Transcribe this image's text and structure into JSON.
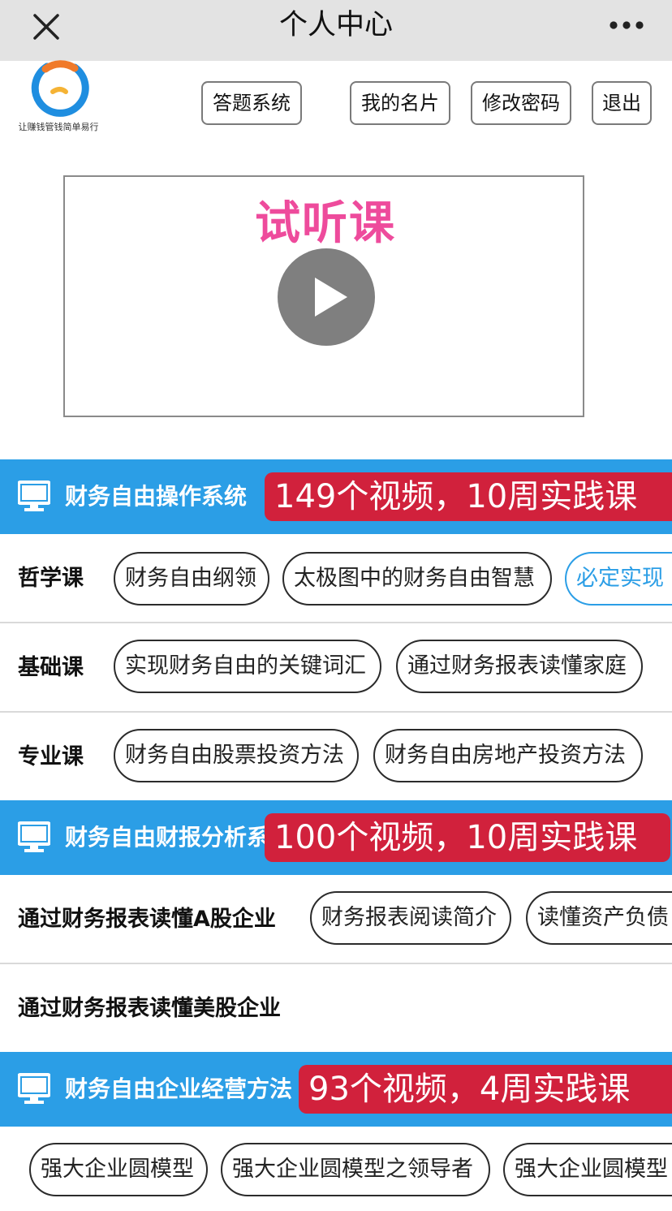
{
  "nav": {
    "title": "个人中心",
    "close_icon": "close-icon",
    "more_icon": "more-icon"
  },
  "header": {
    "logo_icon": "logo-icon",
    "logo_text": "让赚钱管钱简单易行",
    "buttons": [
      "答题系统",
      "我的名片",
      "修改密码",
      "退出"
    ]
  },
  "video": {
    "title": "试听课",
    "play_icon": "play-icon"
  },
  "sections": [
    {
      "title": "财务自由操作系统",
      "badge": "149个视频，10周实践课",
      "icon": "monitor-icon",
      "rows": [
        {
          "label": "哲学课",
          "items": [
            "财务自由纲领",
            "太极图中的财务自由智慧",
            "必定实现"
          ]
        },
        {
          "label": "基础课",
          "items": [
            "实现财务自由的关键词汇",
            "通过财务报表读懂家庭"
          ]
        },
        {
          "label": "专业课",
          "items": [
            "财务自由股票投资方法",
            "财务自由房地产投资方法"
          ]
        }
      ]
    },
    {
      "title": "财务自由财报分析系统",
      "badge": "100个视频，10周实践课",
      "icon": "monitor-icon",
      "rows": [
        {
          "label": "通过财务报表读懂A股企业",
          "items": [
            "财务报表阅读简介",
            "读懂资产负债"
          ]
        },
        {
          "label": "通过财务报表读懂美股企业",
          "items": []
        }
      ]
    },
    {
      "title": "财务自由企业经营方法",
      "badge": "93个视频，4周实践课",
      "icon": "monitor-icon",
      "rows": [
        {
          "label": "",
          "items": [
            "强大企业圆模型",
            "强大企业圆模型之领导者",
            "强大企业圆模型"
          ]
        }
      ]
    }
  ],
  "colors": {
    "nav_bg": "#e3e3e3",
    "section_blue": "#2b9ee6",
    "badge_red": "#d1213c",
    "video_title_pink": "#ee4b9c",
    "logo_orange": "#f07a2a",
    "logo_blue": "#1f8ee0"
  }
}
